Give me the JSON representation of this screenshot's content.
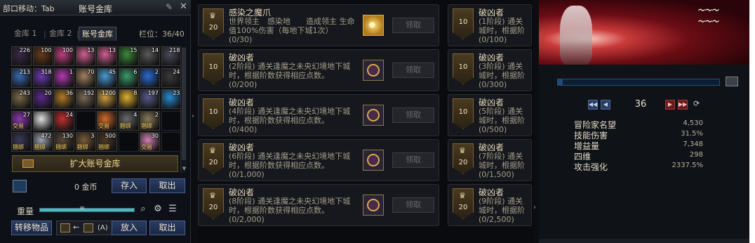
{
  "vault": {
    "hint": "部口移动：Tab",
    "title": "账号金库",
    "tabs": [
      "金库 1",
      "金库 2",
      "账号金库"
    ],
    "slots_label": "栏位：36/40",
    "items": [
      {
        "qty": "226",
        "color": "#3a2a4a",
        "tag": ""
      },
      {
        "qty": "100",
        "color": "#6a3a1a",
        "tag": ""
      },
      {
        "qty": "100",
        "color": "#c04080",
        "tag": ""
      },
      {
        "qty": "13",
        "color": "#d06090",
        "tag": ""
      },
      {
        "qty": "13",
        "color": "#d06090",
        "tag": ""
      },
      {
        "qty": "15",
        "color": "#3a8a3a",
        "tag": ""
      },
      {
        "qty": "14",
        "color": "#5a5a5a",
        "tag": ""
      },
      {
        "qty": "218",
        "color": "#4a4a5a",
        "tag": ""
      },
      {
        "qty": "213",
        "color": "#3a6ab0",
        "tag": ""
      },
      {
        "qty": "318",
        "color": "#6a3ab0",
        "tag": ""
      },
      {
        "qty": "1",
        "color": "#b03ab0",
        "tag": ""
      },
      {
        "qty": "70",
        "color": "#a08060",
        "tag": ""
      },
      {
        "qty": "45",
        "color": "#4a9ad0",
        "tag": ""
      },
      {
        "qty": "6",
        "color": "#3a9a6a",
        "tag": ""
      },
      {
        "qty": "2",
        "color": "#2a6ad0",
        "tag": ""
      },
      {
        "qty": "24",
        "color": "#3a3a3a",
        "tag": ""
      },
      {
        "qty": "243",
        "color": "#7a6a4a",
        "tag": ""
      },
      {
        "qty": "20",
        "color": "#5a2a8a",
        "tag": ""
      },
      {
        "qty": "36",
        "color": "#b07a2a",
        "tag": ""
      },
      {
        "qty": "192",
        "color": "#7a6a5a",
        "tag": ""
      },
      {
        "qty": "1200",
        "color": "#d0a040",
        "tag": ""
      },
      {
        "qty": "8",
        "color": "#e0b030",
        "tag": ""
      },
      {
        "qty": "197",
        "color": "#5a5a8a",
        "tag": ""
      },
      {
        "qty": "23",
        "color": "#2a8ad0",
        "tag": ""
      },
      {
        "qty": "27",
        "color": "#8a3ab0",
        "tag": "交易"
      },
      {
        "qty": "",
        "color": "#e0e0e0",
        "tag": ""
      },
      {
        "qty": "24",
        "color": "#c03030",
        "tag": ""
      },
      {
        "qty": "",
        "color": "",
        "tag": ""
      },
      {
        "qty": "",
        "color": "#d06a2a",
        "tag": "交易"
      },
      {
        "qty": "4",
        "color": "#6a6a6a",
        "tag": "捆绑"
      },
      {
        "qty": "2",
        "color": "#8a7a5a",
        "tag": "捆绑"
      },
      {
        "qty": "",
        "color": "",
        "tag": ""
      },
      {
        "qty": "",
        "color": "#3a3a5a",
        "tag": "捆绑"
      },
      {
        "qty": "472",
        "color": "#a0a0b0",
        "tag": "捆绑"
      },
      {
        "qty": "130",
        "color": "#5a4a3a",
        "tag": "捆绑"
      },
      {
        "qty": "3",
        "color": "#7a5a3a",
        "tag": "捆绑"
      },
      {
        "qty": "500",
        "color": "#4a3a2a",
        "tag": "捆绑"
      },
      {
        "qty": "",
        "color": "",
        "tag": ""
      },
      {
        "qty": "30",
        "color": "#d080b0",
        "tag": "交易"
      },
      {
        "qty": "",
        "color": "",
        "tag": ""
      }
    ],
    "expand_label": "扩大账号金库",
    "gold": "0 金币",
    "deposit_label": "存入",
    "withdraw_label": "取出",
    "weight_label": "重量",
    "weight_value": "∞",
    "transfer_label": "转移物品",
    "transfer_key": "(A)",
    "put_label": "放入",
    "take_label": "取出"
  },
  "achievements": {
    "claim_label": "领取",
    "left": [
      {
        "badge": "20",
        "title": "感染之魔爪",
        "desc": "世界领主　感染地　　造成领主 生命值100%伤害（每地下城1次）",
        "progress": "(0/30)",
        "reward": "gold"
      },
      {
        "badge": "10",
        "title": "破凶者",
        "desc": "(2阶段) 通关逢魔之未央幻境地下城时，根据阶数获得相应点数。",
        "progress": "(0/200)",
        "reward": "emblem"
      },
      {
        "badge": "10",
        "title": "破凶者",
        "desc": "(4阶段) 通关逢魔之未央幻境地下城时，根据阶数获得相应点数。",
        "progress": "(0/400)",
        "reward": "emblem"
      },
      {
        "badge": "20",
        "title": "破凶者",
        "desc": "(6阶段) 通关逢魔之未央幻境地下城时，根据阶数获得相应点数。",
        "progress": "(0/1,000)",
        "reward": "emblem"
      },
      {
        "badge": "20",
        "title": "破凶者",
        "desc": "(8阶段) 通关逢魔之未央幻境地下城时，根据阶数获得相应点数。",
        "progress": "(0/2,000)",
        "reward": "emblem"
      }
    ],
    "right": [
      {
        "badge": "10",
        "title": "破凶者",
        "desc": "(1阶段) 通关 城时，根据阶",
        "progress": "(0/100)"
      },
      {
        "badge": "10",
        "title": "破凶者",
        "desc": "(3阶段) 通关 城时，根据阶",
        "progress": "(0/300)"
      },
      {
        "badge": "10",
        "title": "破凶者",
        "desc": "(5阶段) 通关 城时，根据阶",
        "progress": "(0/500)"
      },
      {
        "badge": "20",
        "title": "破凶者",
        "desc": "(7阶段) 通关 城时，根据阶",
        "progress": "(0/1,500)"
      },
      {
        "badge": "20",
        "title": "破凶者",
        "desc": "(9阶段) 通关 城时，根据阶",
        "progress": "(0/2,500)"
      }
    ]
  },
  "character": {
    "level": "36",
    "stats": [
      {
        "label": "冒险家名望",
        "value": "4,530"
      },
      {
        "label": "技能伤害",
        "value": "31.5%"
      },
      {
        "label": "增益量",
        "value": "7,348"
      },
      {
        "label": "四维",
        "value": "298"
      },
      {
        "label": "攻击强化",
        "value": "2337.5%"
      }
    ]
  }
}
